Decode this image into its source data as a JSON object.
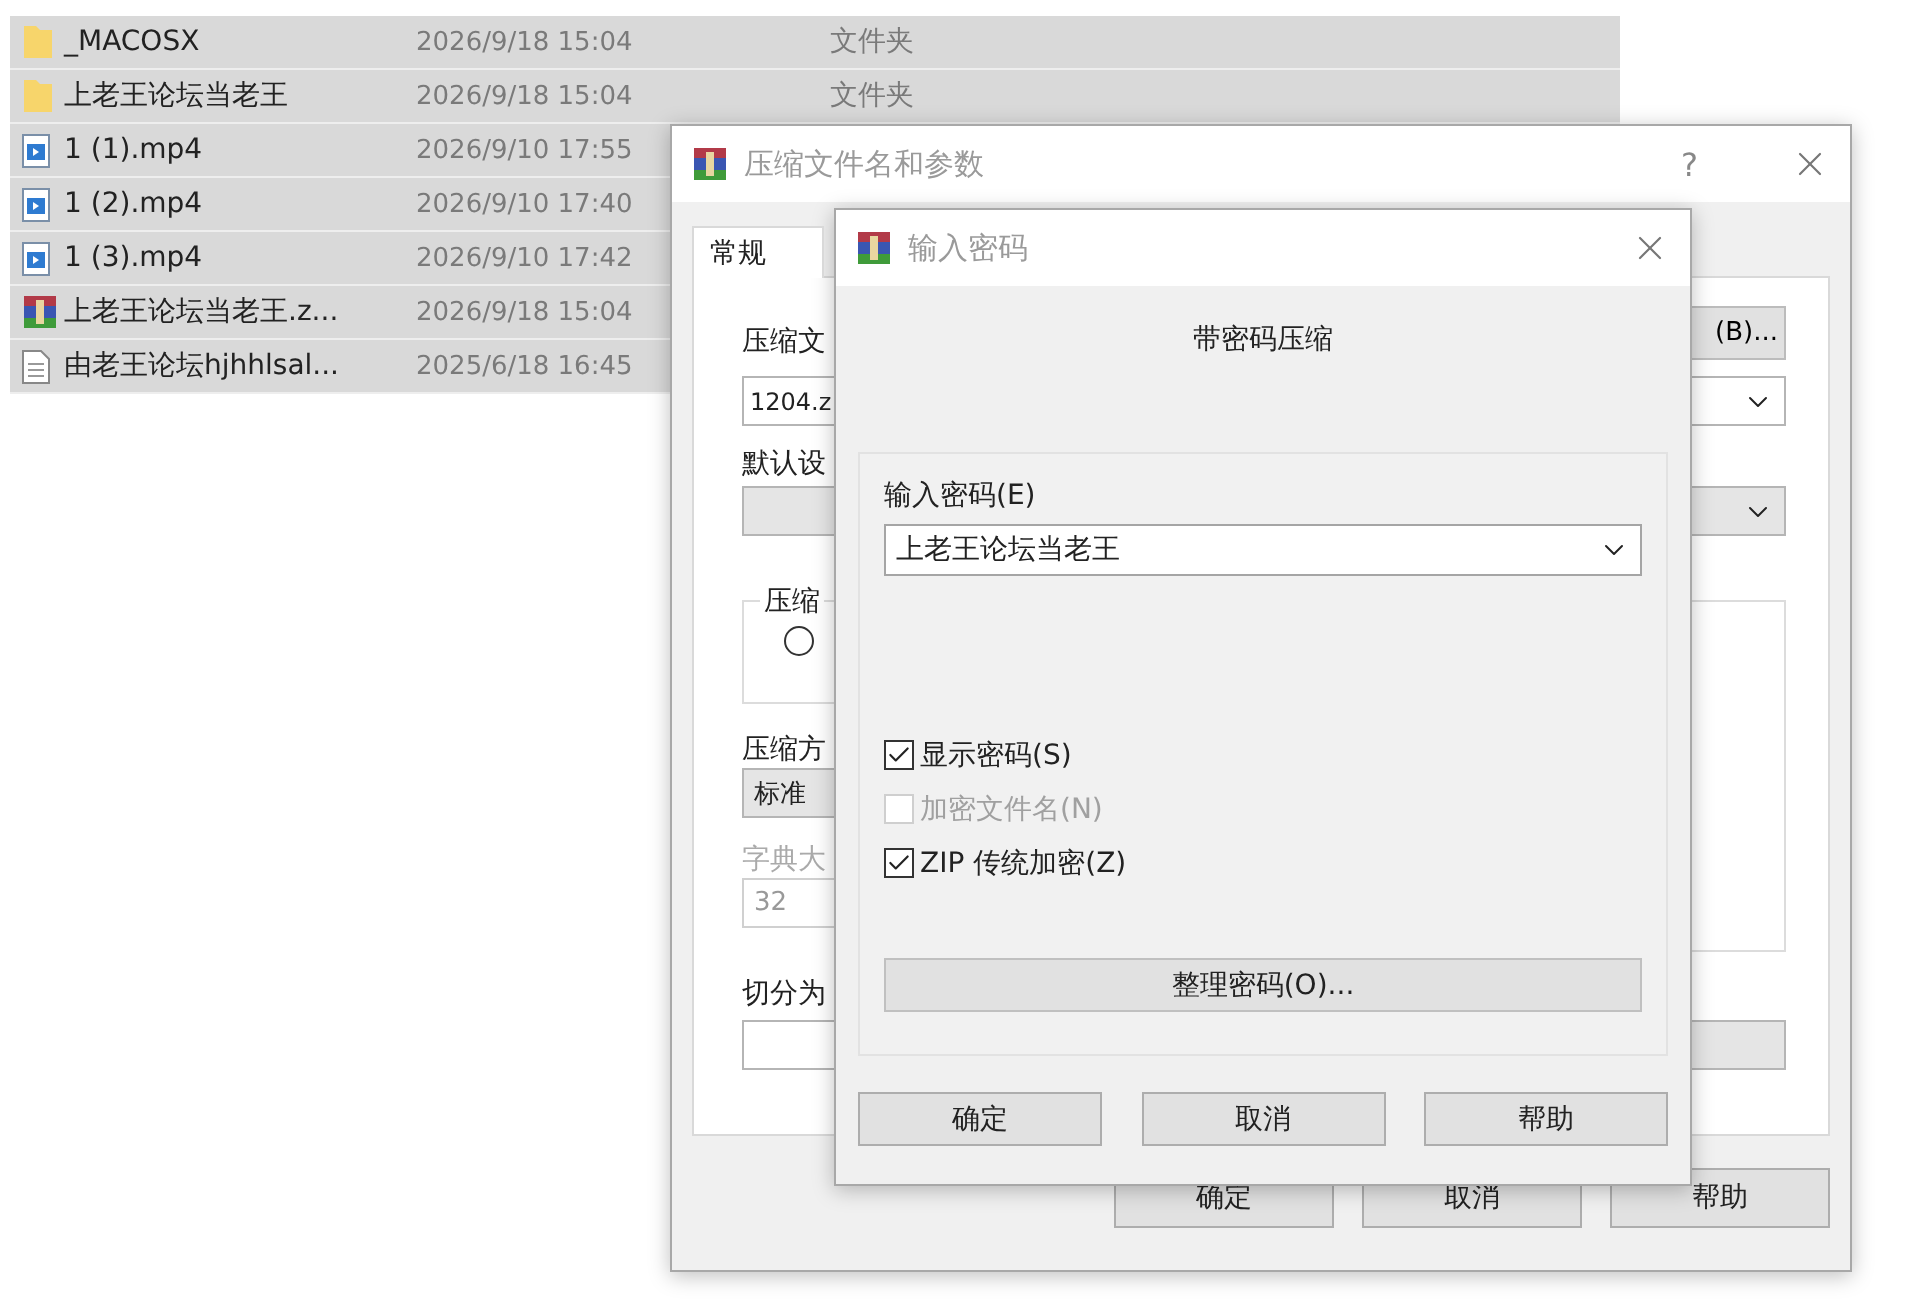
{
  "file_list": {
    "rows": [
      {
        "kind": "folder",
        "name": "_MACOSX",
        "modified": "2026/9/18 15:04",
        "type": "文件夹"
      },
      {
        "kind": "folder",
        "name": "上老王论坛当老王",
        "modified": "2026/9/18 15:04",
        "type": "文件夹"
      },
      {
        "kind": "video",
        "name": "1 (1).mp4",
        "modified": "2026/9/10 17:55"
      },
      {
        "kind": "video",
        "name": "1 (2).mp4",
        "modified": "2026/9/10 17:40"
      },
      {
        "kind": "video",
        "name": "1 (3).mp4",
        "modified": "2026/9/10 17:42"
      },
      {
        "kind": "archive",
        "name": "上老王论坛当老王.z...",
        "modified": "2026/9/18 15:04"
      },
      {
        "kind": "text",
        "name": "由老王论坛hjhhlsal...",
        "modified": "2025/6/18 16:45"
      }
    ]
  },
  "outer_dialog": {
    "title": "压缩文件名和参数",
    "help": "?",
    "tabs": [
      {
        "label": "常规",
        "selected": true
      }
    ],
    "archive_name_label": "压缩文",
    "browse_button": "(B)...",
    "archive_name_value": "1204.z",
    "profile_label": "默认设",
    "format_group_label": "压缩",
    "format_radio": {
      "selected": false
    },
    "method_label": "压缩方",
    "method_value": "标准",
    "dictionary_label": "字典大",
    "dictionary_value": "32",
    "split_label": "切分为",
    "buttons": [
      "确定",
      "取消",
      "帮助"
    ]
  },
  "inner_dialog": {
    "title": "输入密码",
    "heading": "带密码压缩",
    "password_label": "输入密码(E)",
    "password_value": "上老王论坛当老王",
    "options": [
      {
        "label": "显示密码(S)",
        "checked": true,
        "disabled": false
      },
      {
        "label": "加密文件名(N)",
        "checked": false,
        "disabled": true
      },
      {
        "label": "ZIP 传统加密(Z)",
        "checked": true,
        "disabled": false
      }
    ],
    "manage_button": "整理密码(O)...",
    "buttons": [
      "确定",
      "取消",
      "帮助"
    ]
  }
}
